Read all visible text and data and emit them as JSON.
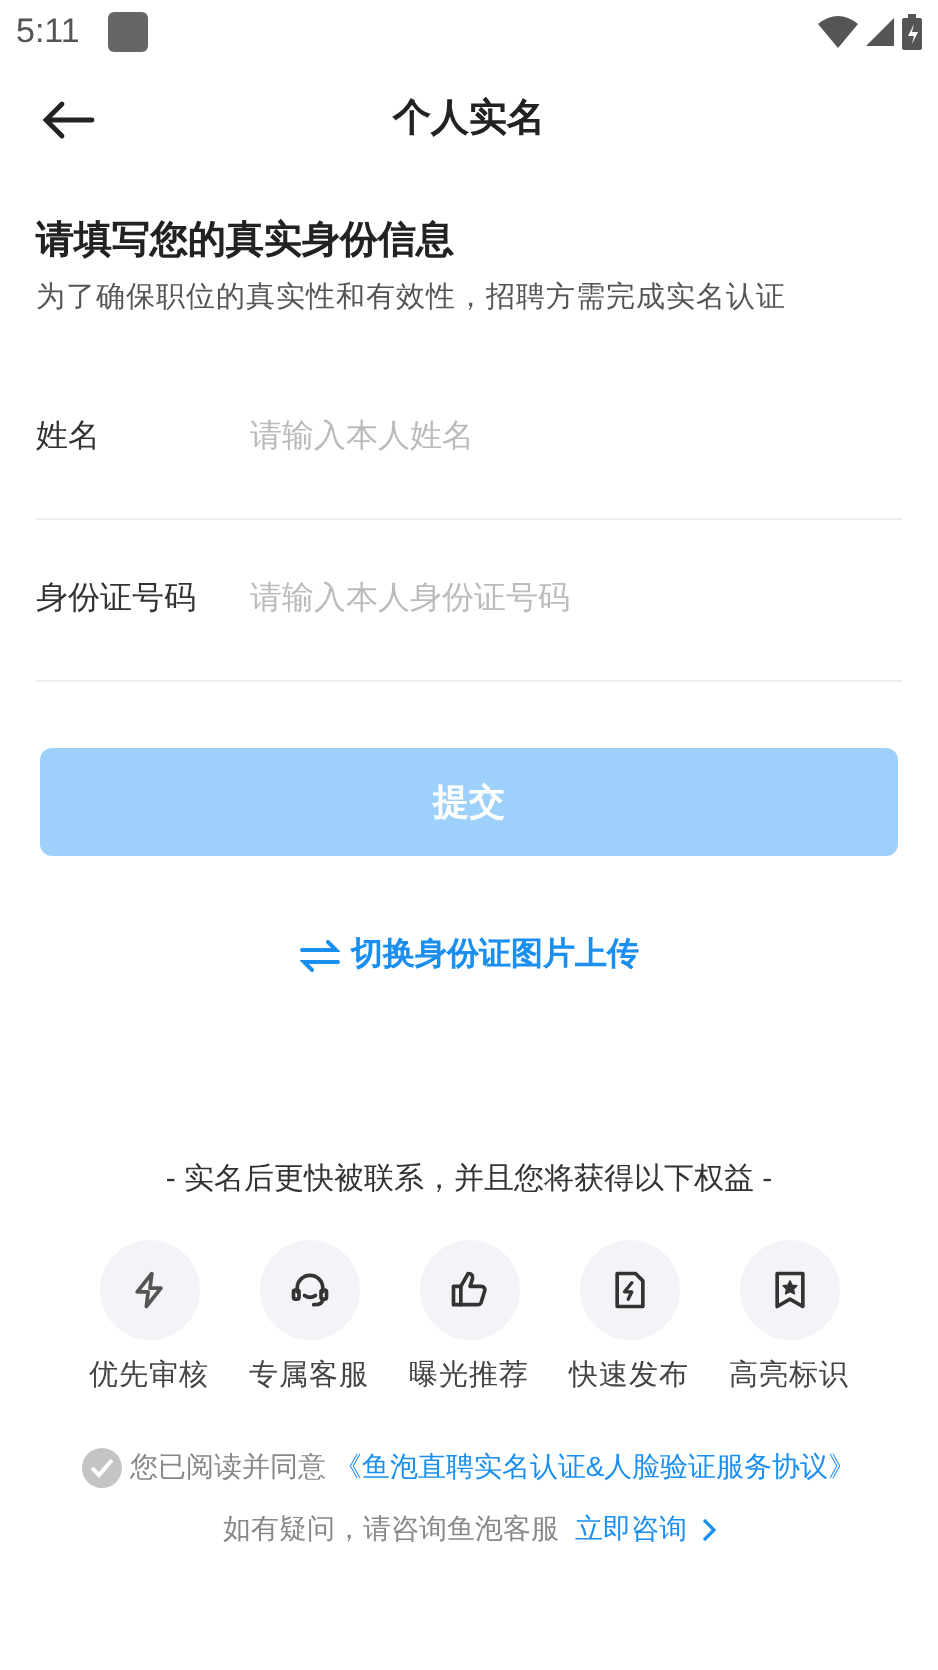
{
  "status_bar": {
    "time": "5:11"
  },
  "header": {
    "title": "个人实名"
  },
  "intro": {
    "heading": "请填写您的真实身份信息",
    "subtitle": "为了确保职位的真实性和有效性，招聘方需完成实名认证"
  },
  "fields": [
    {
      "label": "姓名",
      "placeholder": "请输入本人姓名"
    },
    {
      "label": "身份证号码",
      "placeholder": "请输入本人身份证号码"
    }
  ],
  "submit": {
    "label": "提交",
    "disabled": true
  },
  "switch_link": {
    "label": "切换身份证图片上传"
  },
  "benefits": {
    "title": "- 实名后更快被联系，并且您将获得以下权益 -",
    "items": [
      {
        "kind": "bolt",
        "label": "优先审核"
      },
      {
        "kind": "headset",
        "label": "专属客服"
      },
      {
        "kind": "thumb",
        "label": "曝光推荐"
      },
      {
        "kind": "file-bolt",
        "label": "快速发布"
      },
      {
        "kind": "bookmark-star",
        "label": "高亮标识"
      }
    ]
  },
  "agreement": {
    "checked": false,
    "text": "您已阅读并同意",
    "link": "《鱼泡直聘实名认证&人脸验证服务协议》"
  },
  "help": {
    "text": "如有疑问，请咨询鱼泡客服",
    "link": "立即咨询"
  }
}
